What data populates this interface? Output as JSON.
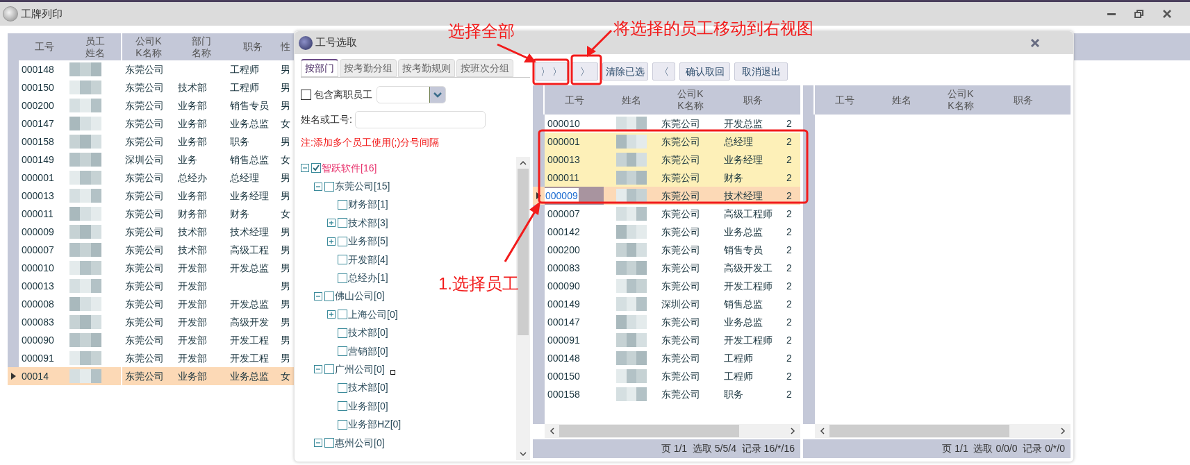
{
  "window": {
    "title": "工牌列印"
  },
  "main_table": {
    "columns": [
      "工号",
      "员工姓名",
      "公司KK名称",
      "部门名称",
      "职务",
      "性"
    ],
    "rows": [
      {
        "cells": [
          "000148",
          "",
          "东莞公司",
          "",
          "工程师",
          "男"
        ],
        "selected": false
      },
      {
        "cells": [
          "000150",
          "",
          "东莞公司",
          "技术部",
          "工程师",
          "男"
        ],
        "selected": false
      },
      {
        "cells": [
          "000200",
          "",
          "东莞公司",
          "业务部",
          "销售专员",
          "男"
        ],
        "selected": false
      },
      {
        "cells": [
          "000147",
          "",
          "东莞公司",
          "业务部",
          "业务总监",
          "女"
        ],
        "selected": false
      },
      {
        "cells": [
          "000158",
          "",
          "东莞公司",
          "业务部",
          "职务",
          "男"
        ],
        "selected": false
      },
      {
        "cells": [
          "000149",
          "",
          "深圳公司",
          "业务",
          "销售总监",
          "女"
        ],
        "selected": false
      },
      {
        "cells": [
          "000001",
          "",
          "东莞公司",
          "总经办",
          "总经理",
          "男"
        ],
        "selected": false
      },
      {
        "cells": [
          "000013",
          "",
          "东莞公司",
          "业务部",
          "业务经理",
          "男"
        ],
        "selected": false
      },
      {
        "cells": [
          "000011",
          "",
          "东莞公司",
          "财务部",
          "财务",
          "女"
        ],
        "selected": false
      },
      {
        "cells": [
          "000009",
          "",
          "东莞公司",
          "技术部",
          "技术经理",
          "男"
        ],
        "selected": false
      },
      {
        "cells": [
          "000007",
          "",
          "东莞公司",
          "技术部",
          "高级工程",
          "男"
        ],
        "selected": false
      },
      {
        "cells": [
          "000010",
          "",
          "东莞公司",
          "开发部",
          "开发总监",
          "男"
        ],
        "selected": false
      },
      {
        "cells": [
          "000013",
          "",
          "东莞公司",
          "开发部",
          "",
          "男"
        ],
        "selected": false
      },
      {
        "cells": [
          "000008",
          "",
          "东莞公司",
          "开发部",
          "开发总监",
          "男"
        ],
        "selected": false
      },
      {
        "cells": [
          "000083",
          "",
          "东莞公司",
          "开发部",
          "高级开发",
          "男"
        ],
        "selected": false
      },
      {
        "cells": [
          "000090",
          "",
          "东莞公司",
          "开发部",
          "开发工程",
          "男"
        ],
        "selected": false
      },
      {
        "cells": [
          "000091",
          "",
          "东莞公司",
          "开发部",
          "开发工程",
          "男"
        ],
        "selected": false
      },
      {
        "cells": [
          "00014",
          "",
          "东莞公司",
          "业务部",
          "业务总监",
          "女"
        ],
        "selected": true
      }
    ]
  },
  "dialog": {
    "title": "工号选取",
    "tabs": [
      {
        "label": "按部门",
        "selected": true
      },
      {
        "label": "按考勤分组",
        "selected": false
      },
      {
        "label": "按考勤规则",
        "selected": false
      },
      {
        "label": "按班次分组",
        "selected": false
      }
    ],
    "include_resigned": {
      "label": "包含离职员工",
      "checked": false
    },
    "name_field": {
      "label": "姓名或工号:"
    },
    "note": "注:添加多个员工使用(;)分号间隔",
    "tree": [
      {
        "label": "智跃软件[16]",
        "checked": true,
        "expanded": true,
        "children": [
          {
            "label": "东莞公司[15]",
            "checked": false,
            "expanded": true,
            "children": [
              {
                "label": "财务部[1]",
                "checked": false
              },
              {
                "label": "技术部[3]",
                "checked": false,
                "expanded": false
              },
              {
                "label": "业务部[5]",
                "checked": false,
                "expanded": false
              },
              {
                "label": "开发部[4]",
                "checked": false
              },
              {
                "label": "总经办[1]",
                "checked": false
              }
            ]
          },
          {
            "label": "佛山公司[0]",
            "checked": false,
            "expanded": true,
            "children": [
              {
                "label": "上海公司[0]",
                "checked": false,
                "expanded": false
              },
              {
                "label": "技术部[0]",
                "checked": false
              },
              {
                "label": "营销部[0]",
                "checked": false
              }
            ]
          },
          {
            "label": "广州公司[0]",
            "checked": false,
            "expanded": true,
            "children": [
              {
                "label": "技术部[0]",
                "checked": false
              },
              {
                "label": "业务部[0]",
                "checked": false
              },
              {
                "label": "业务部HZ[0]",
                "checked": false
              }
            ]
          },
          {
            "label": "惠州公司[0]",
            "checked": false,
            "expanded": true
          }
        ]
      }
    ],
    "buttons": [
      "〉 〉",
      "〉",
      "清除已选",
      "〈",
      "确认取回",
      "取消退出"
    ],
    "selection_table": {
      "columns": [
        "工号",
        "姓名",
        "公司KK名称",
        "职务"
      ],
      "rows": [
        {
          "cells": [
            "000010",
            "",
            "东莞公司",
            "开发总监",
            "2"
          ],
          "selected": false,
          "current": false
        },
        {
          "cells": [
            "000001",
            "",
            "东莞公司",
            "总经理",
            "2"
          ],
          "selected": true,
          "current": false
        },
        {
          "cells": [
            "000013",
            "",
            "东莞公司",
            "业务经理",
            "2"
          ],
          "selected": true,
          "current": false
        },
        {
          "cells": [
            "000011",
            "",
            "东莞公司",
            "财务",
            "2"
          ],
          "selected": true,
          "current": false
        },
        {
          "cells": [
            "000009",
            "",
            "东莞公司",
            "技术经理",
            "2"
          ],
          "selected": true,
          "current": true
        },
        {
          "cells": [
            "000007",
            "",
            "东莞公司",
            "高级工程师",
            "2"
          ],
          "selected": false,
          "current": false
        },
        {
          "cells": [
            "000142",
            "",
            "东莞公司",
            "业务总监",
            "2"
          ],
          "selected": false,
          "current": false
        },
        {
          "cells": [
            "000200",
            "",
            "东莞公司",
            "销售专员",
            "2"
          ],
          "selected": false,
          "current": false
        },
        {
          "cells": [
            "000083",
            "",
            "东莞公司",
            "高级开发工",
            "2"
          ],
          "selected": false,
          "current": false
        },
        {
          "cells": [
            "000090",
            "",
            "东莞公司",
            "开发工程师",
            "2"
          ],
          "selected": false,
          "current": false
        },
        {
          "cells": [
            "000149",
            "",
            "深圳公司",
            "销售总监",
            "2"
          ],
          "selected": false,
          "current": false
        },
        {
          "cells": [
            "000147",
            "",
            "东莞公司",
            "业务总监",
            "2"
          ],
          "selected": false,
          "current": false
        },
        {
          "cells": [
            "000091",
            "",
            "东莞公司",
            "开发工程师",
            "2"
          ],
          "selected": false,
          "current": false
        },
        {
          "cells": [
            "000148",
            "",
            "东莞公司",
            "工程师",
            "2"
          ],
          "selected": false,
          "current": false
        },
        {
          "cells": [
            "000150",
            "",
            "东莞公司",
            "工程师",
            "2"
          ],
          "selected": false,
          "current": false
        },
        {
          "cells": [
            "000158",
            "",
            "东莞公司",
            "职务",
            "2"
          ],
          "selected": false,
          "current": false
        }
      ],
      "status": "页 1/1  选取 5/5/4  记录 16/*/16"
    },
    "result_table": {
      "columns": [
        "工号",
        "姓名",
        "公司KK名称",
        "职务"
      ],
      "status": "页 1/1  选取 0/0/0  记录 0/*/0"
    }
  },
  "annotations": [
    "选择全部",
    "将选择的员工移动到右视图",
    "1.选择员工"
  ]
}
